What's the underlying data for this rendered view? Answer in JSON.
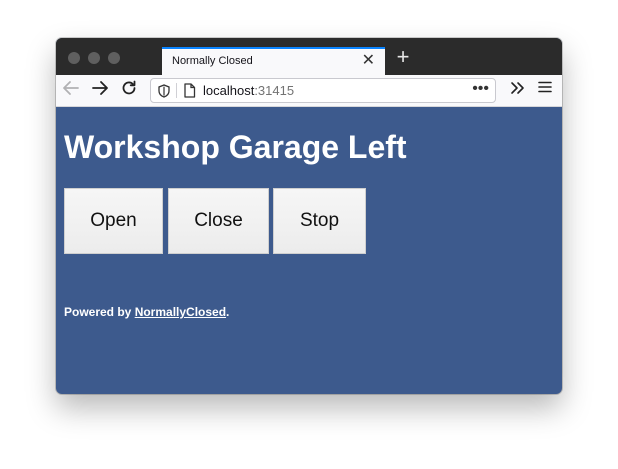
{
  "browser": {
    "tab_title": "Normally Closed",
    "url_host": "localhost",
    "url_port": ":31415"
  },
  "page": {
    "heading": "Workshop Garage Left",
    "buttons": {
      "open": "Open",
      "close": "Close",
      "stop": "Stop"
    },
    "footer": {
      "prefix": "Powered by ",
      "link": "NormallyClosed",
      "suffix": "."
    }
  },
  "colors": {
    "page_background": "#3d5a8d",
    "tab_accent": "#0a84ff"
  },
  "icons": {
    "back": "back-arrow-icon",
    "forward": "forward-arrow-icon",
    "reload": "reload-icon",
    "shield": "shield-icon",
    "page": "page-icon",
    "more": "more-dots-icon",
    "overflow": "overflow-chevrons-icon",
    "menu": "hamburger-menu-icon",
    "close_tab": "close-icon",
    "new_tab": "plus-icon"
  }
}
